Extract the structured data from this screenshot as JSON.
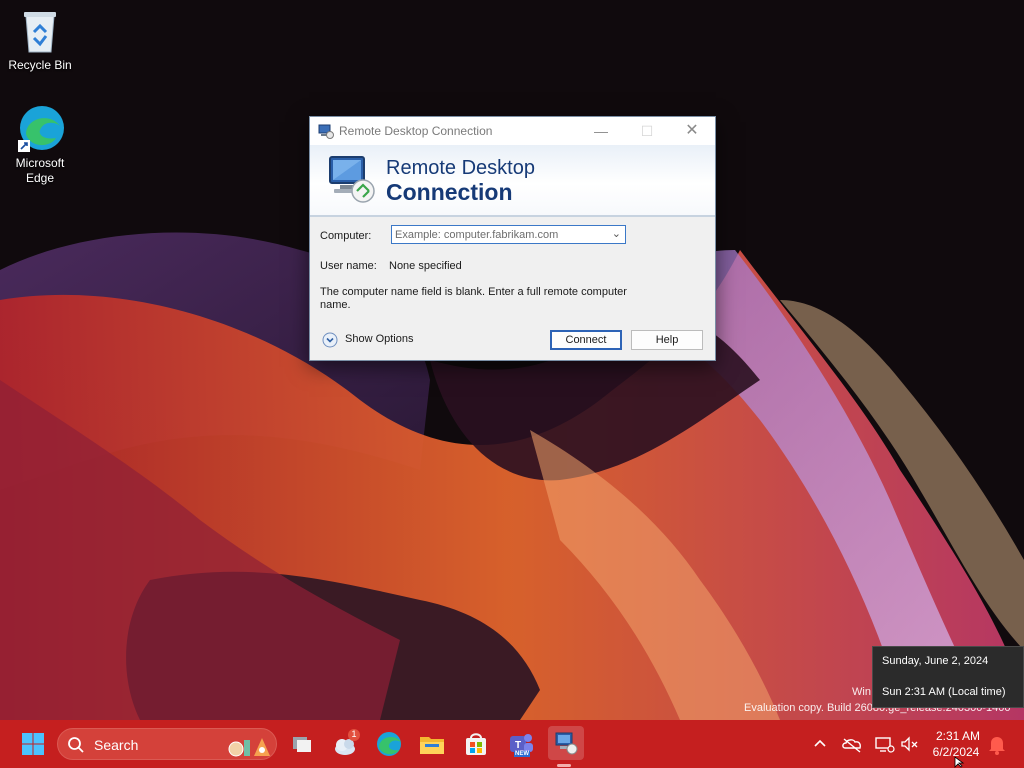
{
  "desktop": {
    "icons": [
      {
        "label": "Recycle Bin",
        "icon": "recycle-bin-icon"
      },
      {
        "label": "Microsoft Edge",
        "icon": "edge-icon"
      }
    ]
  },
  "dialog": {
    "title": "Remote Desktop Connection",
    "banner_line1": "Remote Desktop",
    "banner_line2": "Connection",
    "computer_label": "Computer:",
    "computer_value": "",
    "computer_placeholder": "Example: computer.fabrikam.com",
    "username_label": "User name:",
    "username_value": "None specified",
    "message": "The computer name field is blank. Enter a full remote computer name.",
    "show_options_label": "Show Options",
    "connect_label": "Connect",
    "help_label": "Help"
  },
  "tooltip": {
    "line1": "Sunday, June 2, 2024",
    "line2": "Sun 2:31 AM (Local time)"
  },
  "watermark": {
    "line1": "Win",
    "line2": "Evaluation copy. Build 26080.ge_release.240300-1400"
  },
  "taskbar": {
    "search_label": "Search",
    "weather_badge": "1",
    "clock_time": "2:31 AM",
    "clock_date": "6/2/2024",
    "teams_badge": "NEW"
  },
  "colors": {
    "taskbar": "#c51f1f",
    "dialog_title": "#163a77",
    "accent": "#2d63b6"
  }
}
